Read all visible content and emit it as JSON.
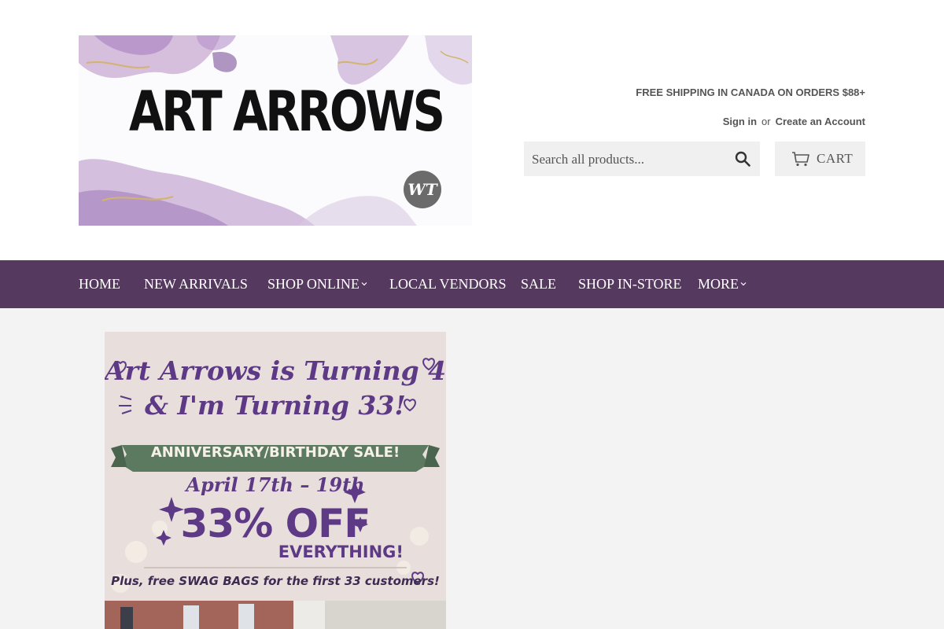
{
  "header": {
    "logo_text": "ART ARROWS",
    "logo_badge": "WT",
    "shipping_notice": "FREE SHIPPING IN CANADA ON ORDERS $88+",
    "sign_in": "Sign in",
    "or": "or",
    "create_account": "Create an Account",
    "search_placeholder": "Search all products...",
    "cart_label": "CART"
  },
  "nav": {
    "items": [
      {
        "label": "HOME"
      },
      {
        "label": "NEW ARRIVALS"
      },
      {
        "label": "SHOP ONLINE"
      },
      {
        "label": "LOCAL VENDORS"
      },
      {
        "label": "SALE"
      },
      {
        "label": "SHOP IN-STORE"
      },
      {
        "label": "MORE"
      }
    ]
  },
  "banner": {
    "title_line1": "Art Arrows is Turning 4...",
    "title_line2": "& I'm Turning 33!",
    "ribbon": "ANNIVERSARY/BIRTHDAY SALE!",
    "dates": "April 17th – 19th",
    "discount": "33% OFF",
    "discount_sub": "EVERYTHING!",
    "swag": "Plus, free SWAG BAGS for the first 33 customers!"
  },
  "colors": {
    "nav_bg": "#56395e",
    "banner_purple": "#5e3a86",
    "ribbon_green": "#5b7a5f"
  }
}
